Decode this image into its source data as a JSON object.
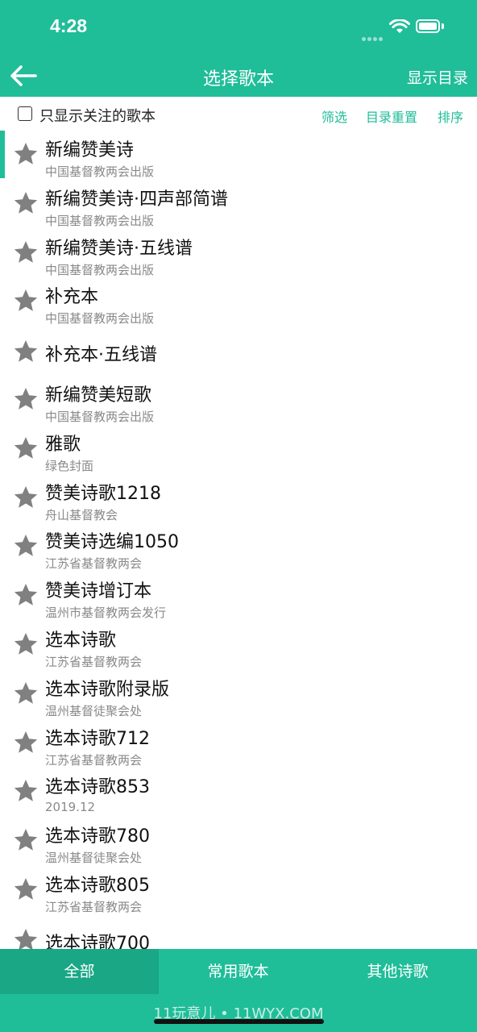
{
  "status_bar": {
    "time": "4:28"
  },
  "header": {
    "title": "选择歌本",
    "right_action": "显示目录"
  },
  "filter_bar": {
    "checkbox_label": "只显示关注的歌本",
    "checked": false,
    "filter": "筛选",
    "reset": "目录重置",
    "sort": "排序"
  },
  "books": [
    {
      "title": "新编赞美诗",
      "subtitle": "中国基督教两会出版"
    },
    {
      "title": "新编赞美诗·四声部简谱",
      "subtitle": "中国基督教两会出版"
    },
    {
      "title": "新编赞美诗·五线谱",
      "subtitle": "中国基督教两会出版"
    },
    {
      "title": "补充本",
      "subtitle": "中国基督教两会出版"
    },
    {
      "title": "补充本·五线谱",
      "subtitle": ""
    },
    {
      "title": "新编赞美短歌",
      "subtitle": "中国基督教两会出版"
    },
    {
      "title": "雅歌",
      "subtitle": "绿色封面"
    },
    {
      "title": "赞美诗歌1218",
      "subtitle": "舟山基督教会"
    },
    {
      "title": "赞美诗选编1050",
      "subtitle": "江苏省基督教两会"
    },
    {
      "title": "赞美诗增订本",
      "subtitle": "温州市基督教两会发行"
    },
    {
      "title": "选本诗歌",
      "subtitle": "江苏省基督教两会"
    },
    {
      "title": "选本诗歌附录版",
      "subtitle": "温州基督徒聚会处"
    },
    {
      "title": "选本诗歌712",
      "subtitle": "江苏省基督教两会"
    },
    {
      "title": "选本诗歌853",
      "subtitle": "2019.12"
    },
    {
      "title": "选本诗歌780",
      "subtitle": "温州基督徒聚会处"
    },
    {
      "title": "选本诗歌805",
      "subtitle": "江苏省基督教两会"
    },
    {
      "title": "选本诗歌700",
      "subtitle": ""
    }
  ],
  "tabs": [
    {
      "label": "全部",
      "active": true
    },
    {
      "label": "常用歌本",
      "active": false
    },
    {
      "label": "其他诗歌",
      "active": false
    }
  ],
  "watermark": "11玩意儿 • 11WYX.COM",
  "colors": {
    "accent": "#20bd99",
    "star": "#808080"
  },
  "icons": {
    "back": "arrow-left-icon",
    "star": "star-icon"
  }
}
